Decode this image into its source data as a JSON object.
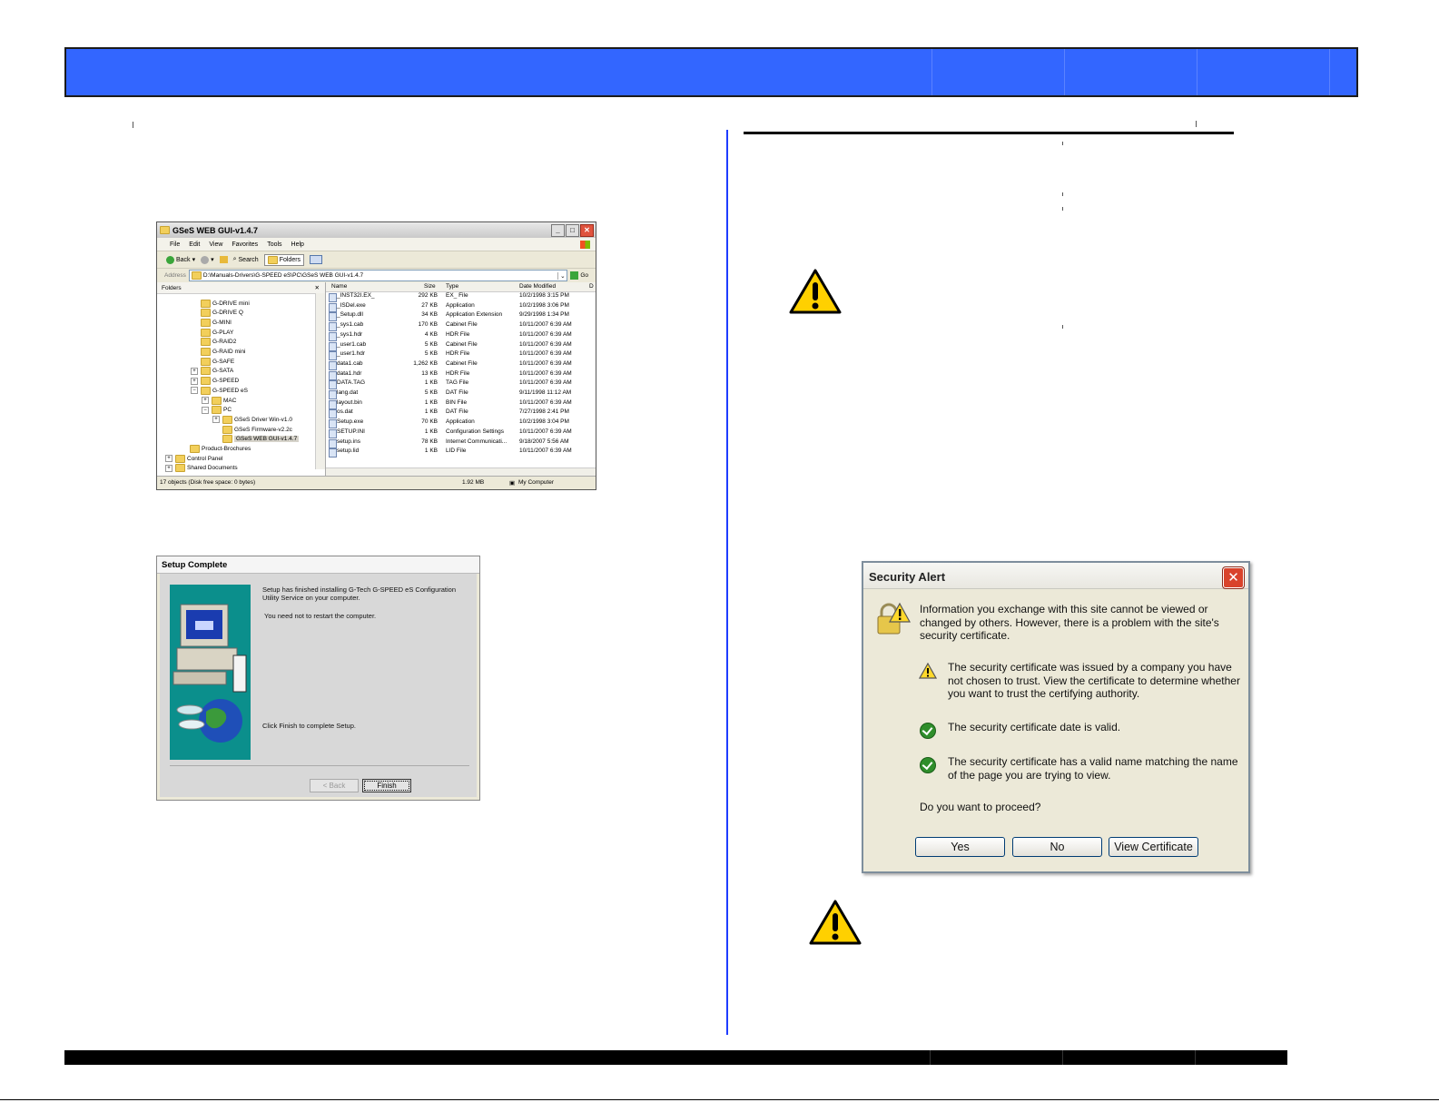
{
  "colors": {
    "header_bar": "#3366ff",
    "divider": "#1e3cff",
    "warning_yellow": "#ffd000"
  },
  "explorer": {
    "title": "GSeS WEB GUI-v1.4.7",
    "menu": [
      "File",
      "Edit",
      "View",
      "Favorites",
      "Tools",
      "Help"
    ],
    "toolbar": {
      "back": "Back",
      "search": "Search",
      "folders": "Folders"
    },
    "address_label": "Address",
    "address_value": "D:\\Manuals-Drivers\\G-SPEED eS\\PC\\GSeS WEB GUI-v1.4.7",
    "go": "Go",
    "folders_header": "Folders",
    "tree": [
      "G-DRIVE mini",
      "G-DRIVE Q",
      "G-MINI",
      "G-PLAY",
      "G-RAID2",
      "G-RAID mini",
      "G-SAFE",
      "G-SATA",
      "G-SPEED",
      "G-SPEED eS",
      "MAC",
      "PC",
      "GSeS Driver Win-v1.0",
      "GSeS Firmware-v2.2c",
      "GSeS WEB GUI-v1.4.7",
      "Product-Brochures",
      "Control Panel",
      "Shared Documents"
    ],
    "columns": [
      "Name",
      "Size",
      "Type",
      "Date Modified",
      "D"
    ],
    "files": [
      [
        "_INST32I.EX_",
        "292 KB",
        "EX_ File",
        "10/2/1998 3:15 PM"
      ],
      [
        "_ISDel.exe",
        "27 KB",
        "Application",
        "10/2/1998 3:06 PM"
      ],
      [
        "_Setup.dll",
        "34 KB",
        "Application Extension",
        "9/29/1998 1:34 PM"
      ],
      [
        "_sys1.cab",
        "170 KB",
        "Cabinet File",
        "10/11/2007 6:39 AM"
      ],
      [
        "_sys1.hdr",
        "4 KB",
        "HDR File",
        "10/11/2007 6:39 AM"
      ],
      [
        "_user1.cab",
        "5 KB",
        "Cabinet File",
        "10/11/2007 6:39 AM"
      ],
      [
        "_user1.hdr",
        "5 KB",
        "HDR File",
        "10/11/2007 6:39 AM"
      ],
      [
        "data1.cab",
        "1,262 KB",
        "Cabinet File",
        "10/11/2007 6:39 AM"
      ],
      [
        "data1.hdr",
        "13 KB",
        "HDR File",
        "10/11/2007 6:39 AM"
      ],
      [
        "DATA.TAG",
        "1 KB",
        "TAG File",
        "10/11/2007 6:39 AM"
      ],
      [
        "lang.dat",
        "5 KB",
        "DAT File",
        "9/11/1998 11:12 AM"
      ],
      [
        "layout.bin",
        "1 KB",
        "BIN File",
        "10/11/2007 6:39 AM"
      ],
      [
        "os.dat",
        "1 KB",
        "DAT File",
        "7/27/1998 2:41 PM"
      ],
      [
        "Setup.exe",
        "70 KB",
        "Application",
        "10/2/1998 3:04 PM"
      ],
      [
        "SETUP.INI",
        "1 KB",
        "Configuration Settings",
        "10/11/2007 6:39 AM"
      ],
      [
        "setup.ins",
        "78 KB",
        "Internet Communicati...",
        "9/18/2007 5:56 AM"
      ],
      [
        "setup.lid",
        "1 KB",
        "LID File",
        "10/11/2007 6:39 AM"
      ]
    ],
    "status": {
      "objects": "17 objects (Disk free space: 0 bytes)",
      "size": "1.92 MB",
      "location": "My Computer"
    }
  },
  "setup": {
    "title": "Setup Complete",
    "message1": "Setup has finished installing G-Tech G-SPEED eS Configuration Utility Service on your computer.",
    "message2": "You need not to restart the computer.",
    "message3": "Click Finish to complete Setup.",
    "back_label": "< Back",
    "finish_label": "Finish"
  },
  "security_alert": {
    "title": "Security Alert",
    "intro": "Information you exchange with this site cannot be viewed or changed by others. However, there is a problem with the site's security certificate.",
    "item1": "The security certificate was issued by a company you have not chosen to trust. View the certificate to determine whether you want to trust the certifying authority.",
    "item2": "The security certificate date is valid.",
    "item3": "The security certificate has a valid name matching the name of the page you are trying to view.",
    "question": "Do you want to proceed?",
    "yes_label": "Yes",
    "no_label": "No",
    "view_cert_label": "View Certificate"
  }
}
